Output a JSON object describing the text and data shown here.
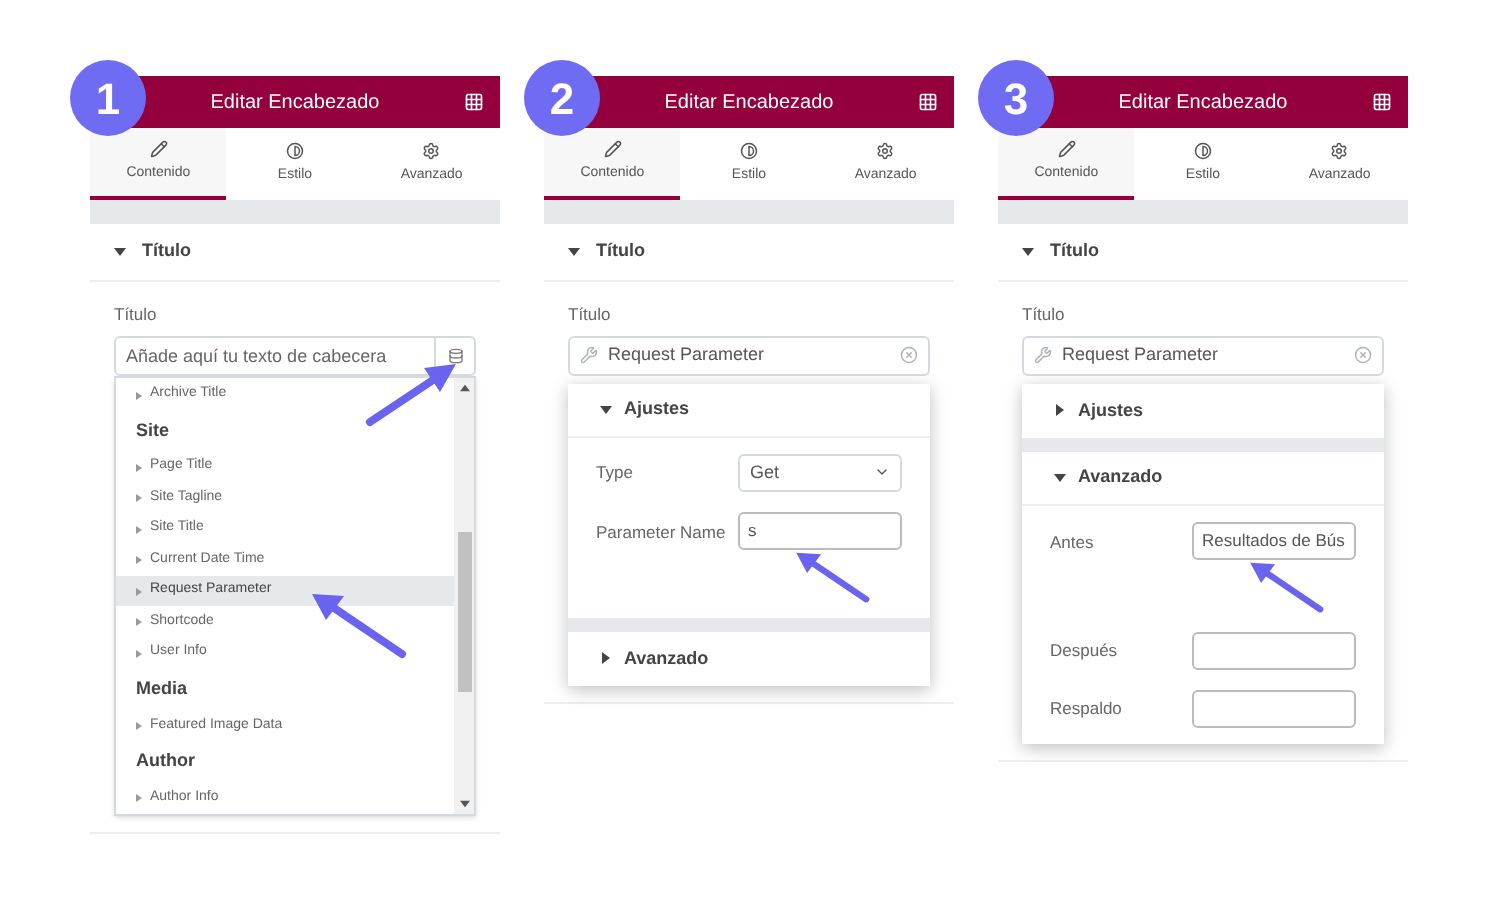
{
  "steps": [
    {
      "number": "1",
      "title": "Editar Encabezado",
      "tabs": [
        {
          "label": "Contenido",
          "selected": true
        },
        {
          "label": "Estilo",
          "selected": false
        },
        {
          "label": "Avanzado",
          "selected": false
        }
      ],
      "section": "Título",
      "field_label": "Título",
      "field": {
        "kind": "empty",
        "placeholder": "Añade aquí tu texto de cabecera",
        "arrow": true
      },
      "popup": {
        "kind": "list",
        "items": [
          {
            "kind": "item",
            "label": "Archive Title",
            "selected": false
          },
          {
            "kind": "group",
            "label": "Site"
          },
          {
            "kind": "item",
            "label": "Page Title",
            "selected": false
          },
          {
            "kind": "item",
            "label": "Site Tagline",
            "selected": false
          },
          {
            "kind": "item",
            "label": "Site Title",
            "selected": false
          },
          {
            "kind": "item",
            "label": "Current Date Time",
            "selected": false
          },
          {
            "kind": "item",
            "label": "Request Parameter",
            "selected": true,
            "arrow": true
          },
          {
            "kind": "item",
            "label": "Shortcode",
            "selected": false
          },
          {
            "kind": "item",
            "label": "User Info",
            "selected": false
          },
          {
            "kind": "group",
            "label": "Media"
          },
          {
            "kind": "item",
            "label": "Featured Image Data",
            "selected": false
          },
          {
            "kind": "group",
            "label": "Author"
          },
          {
            "kind": "item",
            "label": "Author Info",
            "selected": false
          }
        ]
      }
    },
    {
      "number": "2",
      "title": "Editar Encabezado",
      "tabs": [
        {
          "label": "Contenido",
          "selected": true
        },
        {
          "label": "Estilo",
          "selected": false
        },
        {
          "label": "Avanzado",
          "selected": false
        }
      ],
      "section": "Título",
      "field_label": "Título",
      "field": {
        "kind": "tag",
        "value": "Request Parameter"
      },
      "popup": {
        "kind": "settings",
        "sections": [
          {
            "title": "Ajustes",
            "expanded": true,
            "rows": [
              {
                "label": "Type",
                "kind": "select",
                "value": "Get"
              },
              {
                "label": "Parameter Name",
                "kind": "input",
                "value": "s",
                "arrow": true
              }
            ]
          },
          {
            "title": "Avanzado",
            "expanded": false
          }
        ]
      }
    },
    {
      "number": "3",
      "title": "Editar Encabezado",
      "tabs": [
        {
          "label": "Contenido",
          "selected": true
        },
        {
          "label": "Estilo",
          "selected": false
        },
        {
          "label": "Avanzado",
          "selected": false
        }
      ],
      "section": "Título",
      "field_label": "Título",
      "field": {
        "kind": "tag",
        "value": "Request Parameter"
      },
      "popup": {
        "kind": "settings",
        "sections": [
          {
            "title": "Ajustes",
            "expanded": false
          },
          {
            "title": "Avanzado",
            "expanded": true,
            "rows": [
              {
                "label": "Antes",
                "kind": "input",
                "value": "Resultados de Bús",
                "arrow": true
              },
              {
                "label": "Después",
                "kind": "input"
              },
              {
                "label": "Respaldo",
                "kind": "input"
              }
            ]
          }
        ]
      }
    }
  ]
}
